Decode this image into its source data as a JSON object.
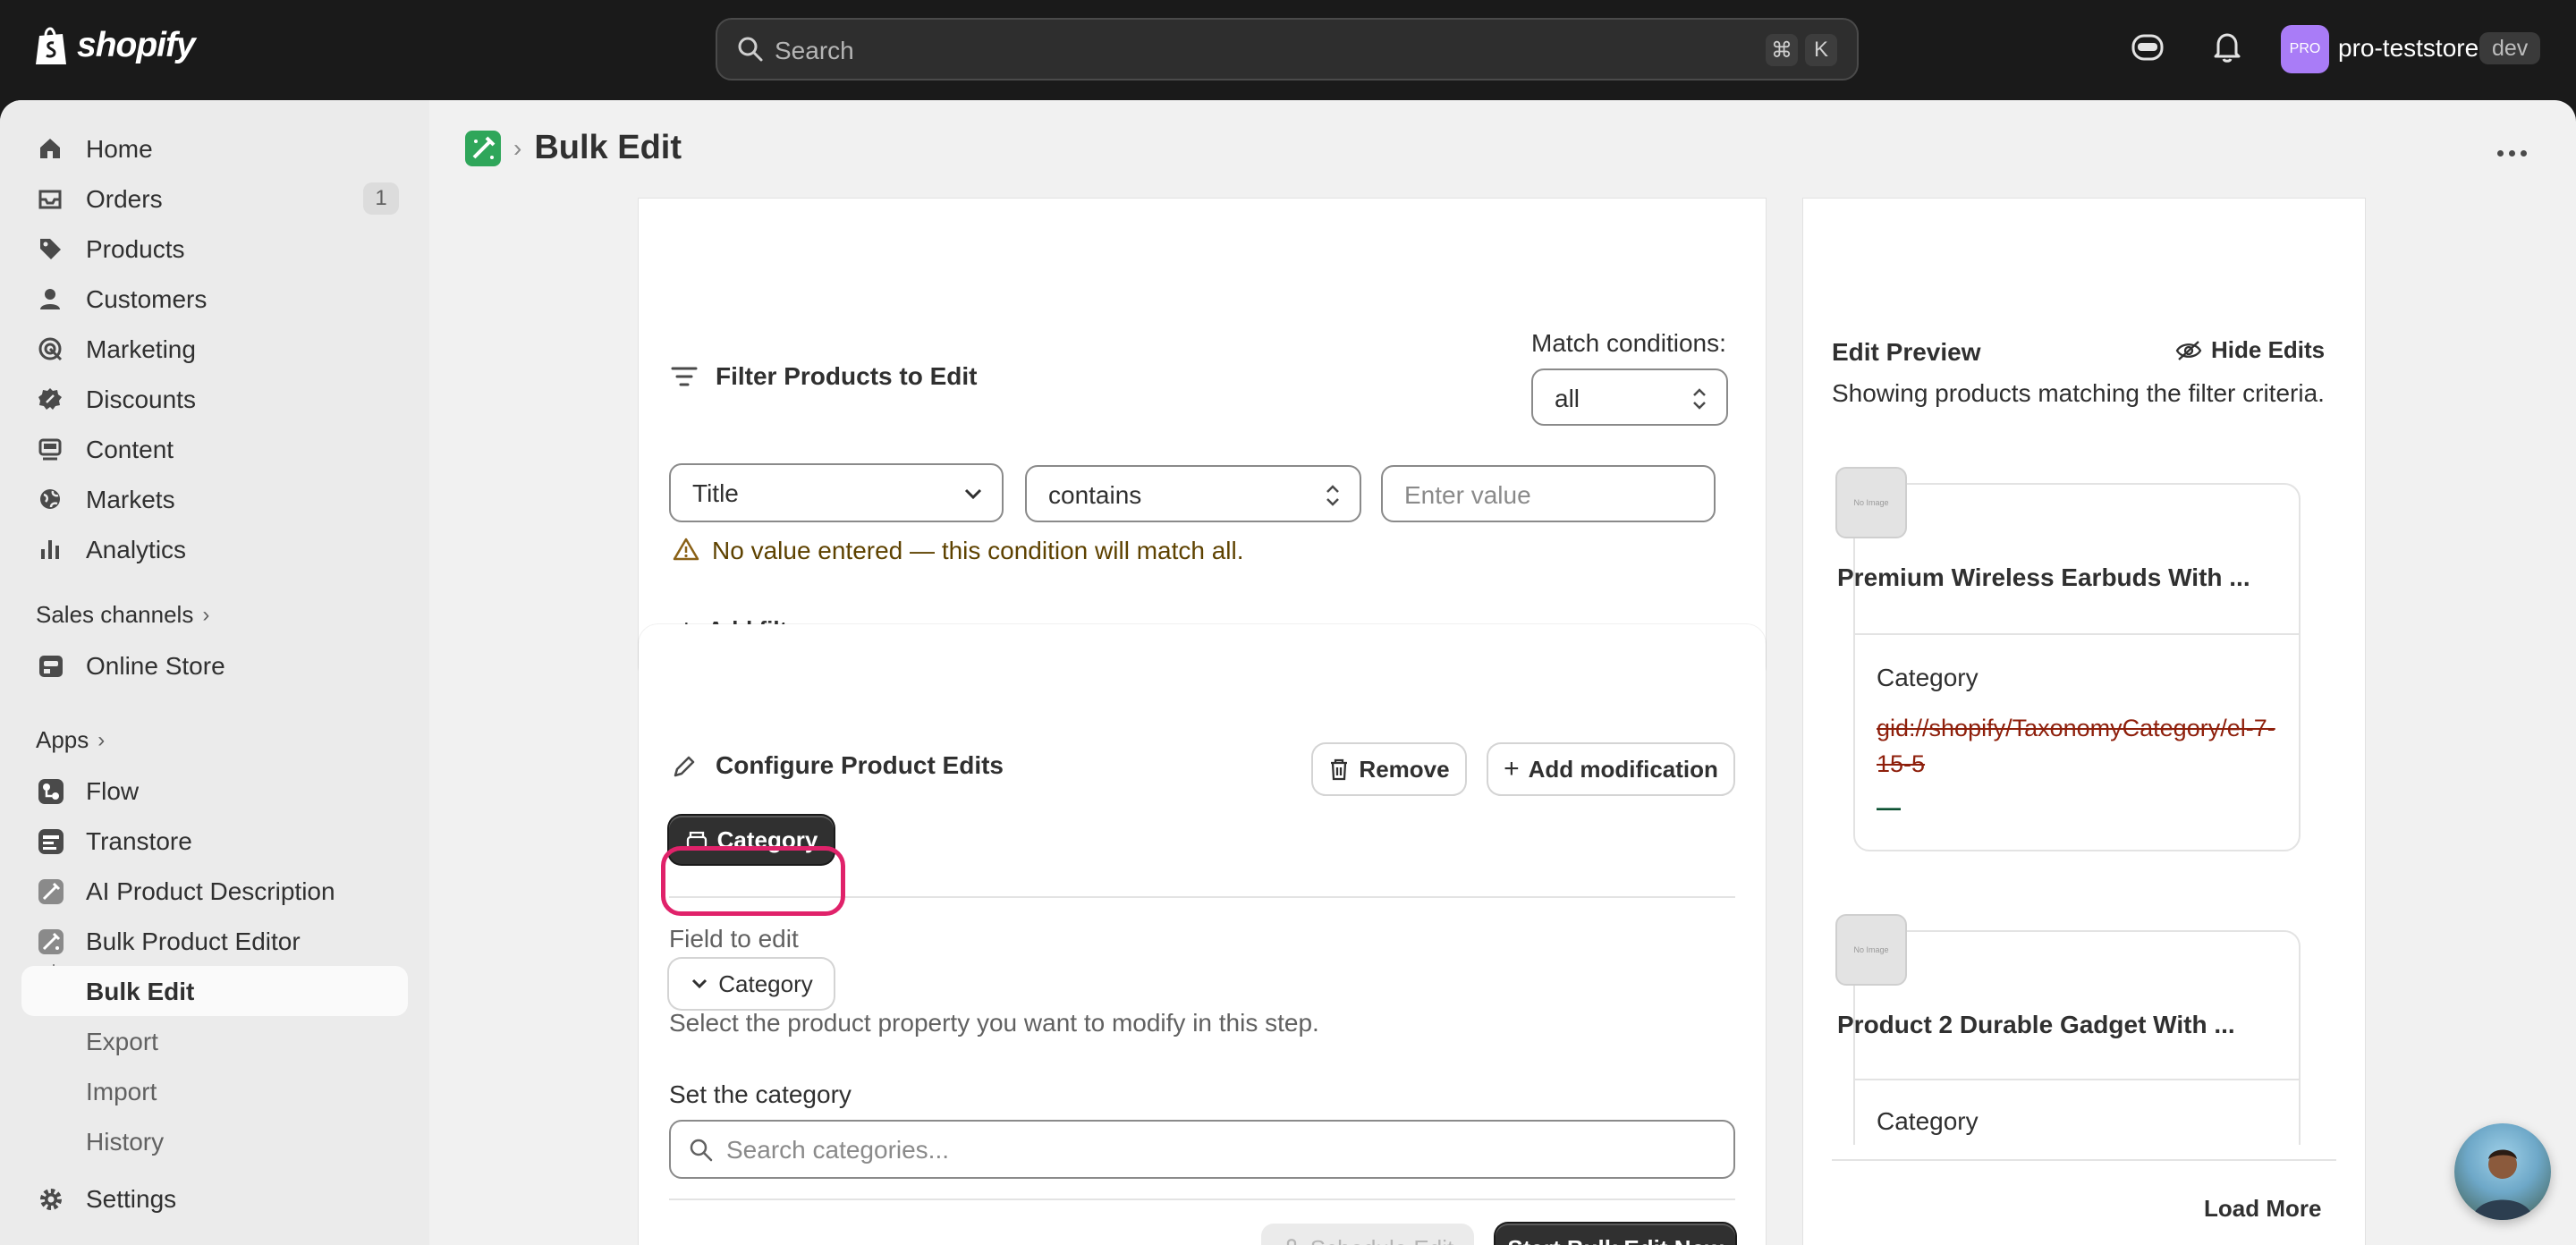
{
  "brand": {
    "name": "shopify"
  },
  "search": {
    "placeholder": "Search",
    "shortcut_key1": "⌘",
    "shortcut_key2": "K"
  },
  "account": {
    "avatar_text": "PRO",
    "store": "pro-teststore",
    "badge": "dev"
  },
  "sidebar": {
    "items": [
      {
        "label": "Home",
        "icon": "home-icon"
      },
      {
        "label": "Orders",
        "icon": "inbox-icon",
        "badge": "1"
      },
      {
        "label": "Products",
        "icon": "tag-icon"
      },
      {
        "label": "Customers",
        "icon": "person-icon"
      },
      {
        "label": "Marketing",
        "icon": "target-icon"
      },
      {
        "label": "Discounts",
        "icon": "discount-icon"
      },
      {
        "label": "Content",
        "icon": "content-icon"
      },
      {
        "label": "Markets",
        "icon": "globe-icon"
      },
      {
        "label": "Analytics",
        "icon": "bar-chart-icon"
      }
    ],
    "sales_channels_label": "Sales channels",
    "online_store": "Online Store",
    "apps_label": "Apps",
    "apps": [
      {
        "label": "Flow"
      },
      {
        "label": "Transtore"
      },
      {
        "label": "AI Product Description"
      },
      {
        "label": "Bulk Product Editor"
      }
    ],
    "app_sub": [
      "Bulk Edit",
      "Export",
      "Import",
      "History"
    ],
    "settings": "Settings"
  },
  "header": {
    "title": "Bulk Edit"
  },
  "filter": {
    "title": "Filter Products to Edit",
    "match_label": "Match conditions:",
    "match_value": "all",
    "field": "Title",
    "operator": "contains",
    "value_placeholder": "Enter value",
    "warning": "No value entered — this condition will match all.",
    "add_filter": "Add filter"
  },
  "configure": {
    "title": "Configure Product Edits",
    "remove": "Remove",
    "add_modification": "Add modification",
    "active_tab": "Category",
    "field_to_edit_label": "Field to edit",
    "field_selected": "Category",
    "field_help": "Select the product property you want to modify in this step.",
    "set_category_label": "Set the category",
    "category_search_placeholder": "Search categories...",
    "schedule": "Schedule Edit",
    "start": "Start Bulk Edit Now"
  },
  "preview": {
    "title": "Edit Preview",
    "hide": "Hide Edits",
    "subtitle": "Showing products matching the filter criteria.",
    "no_image": "No Image",
    "products": [
      {
        "name": "Premium Wireless Earbuds With ...",
        "field": "Category",
        "old_value": "gid://shopify/TaxonomyCategory/el-7-15-5",
        "new_value": "—"
      },
      {
        "name": "Product 2 Durable Gadget With ...",
        "field": "Category"
      }
    ],
    "load_more": "Load More"
  }
}
